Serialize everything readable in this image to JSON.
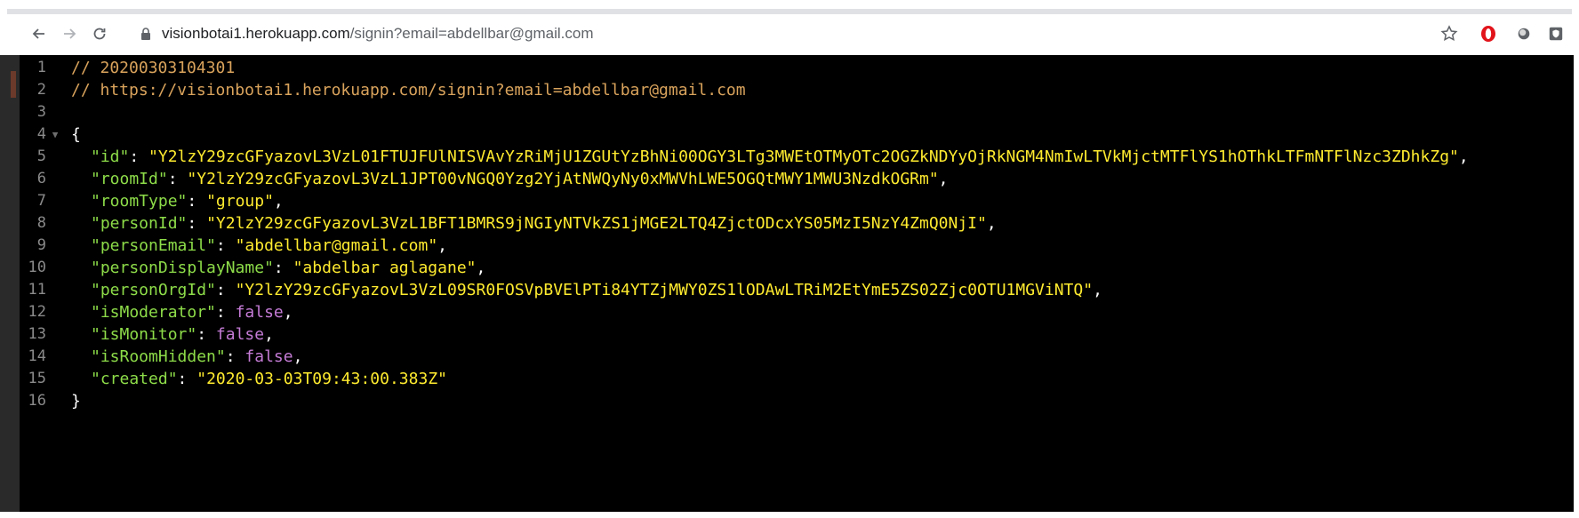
{
  "browser": {
    "url_host": "visionbotai1.herokuapp.com",
    "url_path": "/signin?email=abdellbar@gmail.com"
  },
  "icons": {
    "back": "arrow-left-icon",
    "forward": "arrow-right-icon",
    "reload": "reload-icon",
    "lock": "lock-icon",
    "star": "star-icon",
    "opera": "opera-icon",
    "extension1": "circle-extension-icon",
    "extension2": "shield-extension-icon"
  },
  "colors": {
    "comment": "#d9a35c",
    "key": "#8ddc49",
    "string": "#ffeb2f",
    "boolean": "#c47bd5",
    "background": "#000000"
  },
  "editor": {
    "line_numbers": [
      "1",
      "2",
      "3",
      "4",
      "5",
      "6",
      "7",
      "8",
      "9",
      "10",
      "11",
      "12",
      "13",
      "14",
      "15",
      "16"
    ],
    "comment1": "// 20200303104301",
    "comment2": "// https://visionbotai1.herokuapp.com/signin?email=abdellbar@gmail.com",
    "open_brace": "{",
    "close_brace": "}",
    "fields": [
      {
        "key": "\"id\"",
        "value": "\"Y2lzY29zcGFyazovL3VzL01FTUJFUlNISVAvYzRiMjU1ZGUtYzBhNi00OGY3LTg3MWEtOTMyOTc2OGZkNDYyOjRkNGM4NmIwLTVkMjctMTFlYS1hOThkLTFmNTFlNzc3ZDhkZg\"",
        "sep": ","
      },
      {
        "key": "\"roomId\"",
        "value": "\"Y2lzY29zcGFyazovL3VzL1JPT00vNGQ0Yzg2YjAtNWQyNy0xMWVhLWE5OGQtMWY1MWU3NzdkOGRm\"",
        "sep": ","
      },
      {
        "key": "\"roomType\"",
        "value": "\"group\"",
        "sep": ","
      },
      {
        "key": "\"personId\"",
        "value": "\"Y2lzY29zcGFyazovL3VzL1BFT1BMRS9jNGIyNTVkZS1jMGE2LTQ4ZjctODcxYS05MzI5NzY4ZmQ0NjI\"",
        "sep": ","
      },
      {
        "key": "\"personEmail\"",
        "value": "\"abdellbar@gmail.com\"",
        "sep": ","
      },
      {
        "key": "\"personDisplayName\"",
        "value": "\"abdelbar aglagane\"",
        "sep": ","
      },
      {
        "key": "\"personOrgId\"",
        "value": "\"Y2lzY29zcGFyazovL3VzL09SR0FOSVpBVElPTi84YTZjMWY0ZS1lODAwLTRiM2EtYmE5ZS02Zjc0OTU1MGViNTQ\"",
        "sep": ","
      },
      {
        "key": "\"isModerator\"",
        "value": "false",
        "sep": ","
      },
      {
        "key": "\"isMonitor\"",
        "value": "false",
        "sep": ","
      },
      {
        "key": "\"isRoomHidden\"",
        "value": "false",
        "sep": ","
      },
      {
        "key": "\"created\"",
        "value": "\"2020-03-03T09:43:00.383Z\"",
        "sep": ""
      }
    ],
    "colon": ": "
  }
}
